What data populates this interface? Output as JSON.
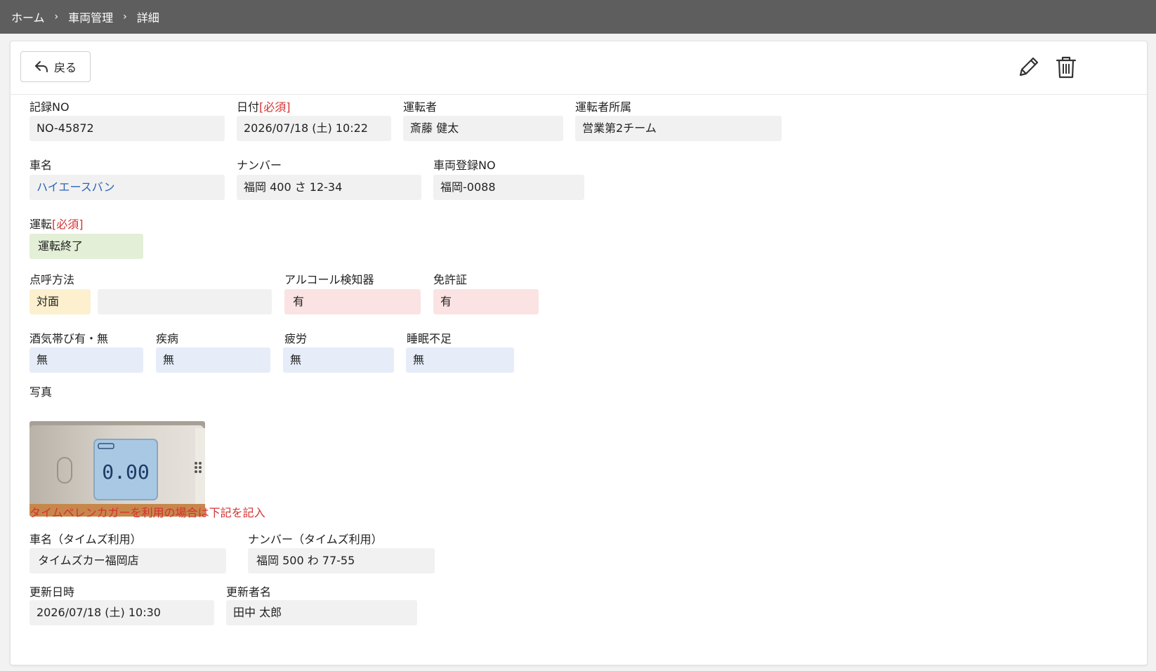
{
  "breadcrumb": {
    "home": "ホーム",
    "vehicles": "車両管理",
    "detail": "詳細",
    "separator": "›"
  },
  "toolbar": {
    "back_label": "戻る"
  },
  "fields": {
    "record_no": {
      "label": "記録NO",
      "value": "NO-45872"
    },
    "date": {
      "label": "日付",
      "required": "[必須]",
      "value": "2026/07/18 (土) 10:22"
    },
    "driver": {
      "label": "運転者",
      "value": "斎藤 健太"
    },
    "driver_dept": {
      "label": "運転者所属",
      "value": "営業第2チーム"
    },
    "car_name": {
      "label": "車名",
      "value": "ハイエースバン"
    },
    "plate": {
      "label": "ナンバー",
      "value": "福岡 400 さ 12-34"
    },
    "vehicle_reg_no": {
      "label": "車両登録NO",
      "value": "福岡-0088"
    },
    "driving": {
      "label": "運転",
      "required": "[必須]",
      "value": "運転終了"
    },
    "rollcall": {
      "label": "点呼方法",
      "value": "対面",
      "extra": ""
    },
    "alcohol_detector": {
      "label": "アルコール検知器",
      "value": "有"
    },
    "license": {
      "label": "免許証",
      "value": "有"
    },
    "alcohol": {
      "label": "酒気帯び有・無",
      "value": "無"
    },
    "illness": {
      "label": "疾病",
      "value": "無"
    },
    "fatigue": {
      "label": "疲労",
      "value": "無"
    },
    "sleep": {
      "label": "睡眠不足",
      "value": "無"
    },
    "photo": {
      "label": "写真",
      "reading": "0.00"
    },
    "times_note": "タイムペレンカガーを利用の場合は下記を記入",
    "times_car": {
      "label": "車名（タイムズ利用）",
      "value": "タイムズカー福岡店"
    },
    "times_plate": {
      "label": "ナンバー（タイムズ利用）",
      "value": "福岡 500 わ 77-55"
    },
    "updated_at": {
      "label": "更新日時",
      "value": "2026/07/18 (土) 10:30"
    },
    "updated_by": {
      "label": "更新者名",
      "value": "田中 太郎"
    }
  },
  "colors": {
    "topbar": "#5e5e5e",
    "required": "#d63031",
    "link": "#2a63b8",
    "status_green": "#e3efd6",
    "status_yellow": "#fdf0cf",
    "status_pink": "#fbe3e3",
    "status_blue": "#e6edf8"
  },
  "icons": {
    "back": "arrow-left-icon",
    "edit": "pencil-icon",
    "delete": "trash-icon"
  }
}
